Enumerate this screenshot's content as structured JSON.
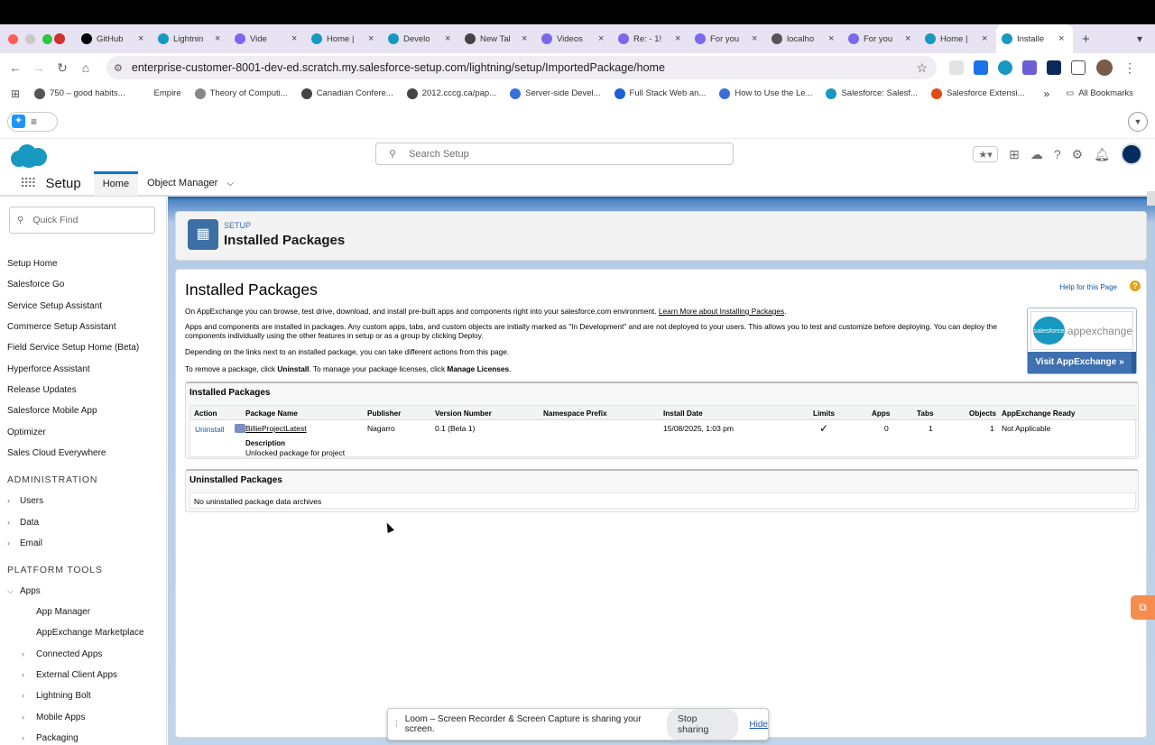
{
  "browser": {
    "tabs": [
      {
        "label": "GitHub",
        "icon": "github-icon",
        "color": "#000000"
      },
      {
        "label": "Lightnin",
        "icon": "salesforce-icon",
        "color": "#1798c1"
      },
      {
        "label": "Vide",
        "icon": "video-icon",
        "color": "#7b68ee"
      },
      {
        "label": "Home |",
        "icon": "salesforce-icon",
        "color": "#1798c1"
      },
      {
        "label": "Develo",
        "icon": "salesforce-icon",
        "color": "#1798c1"
      },
      {
        "label": "New Tal",
        "icon": "chrome-icon",
        "color": "#444444"
      },
      {
        "label": "Videos",
        "icon": "video-icon",
        "color": "#7b68ee"
      },
      {
        "label": "Re: - 1!",
        "icon": "video-icon",
        "color": "#7b68ee"
      },
      {
        "label": "For you",
        "icon": "video-icon",
        "color": "#7b68ee"
      },
      {
        "label": "localho",
        "icon": "globe-icon",
        "color": "#555555"
      },
      {
        "label": "For you",
        "icon": "video-icon",
        "color": "#7b68ee"
      },
      {
        "label": "Home |",
        "icon": "salesforce-icon",
        "color": "#1798c1"
      },
      {
        "label": "Installe",
        "icon": "salesforce-icon",
        "color": "#1798c1",
        "active": true
      }
    ],
    "url": "enterprise-customer-8001-dev-ed.scratch.my.salesforce-setup.com/lightning/setup/ImportedPackage/home",
    "bookmarks": [
      {
        "label": "750 – good habits...",
        "color": "#555555"
      },
      {
        "label": "Empire",
        "color": "#ffffff"
      },
      {
        "label": "Theory of Computi...",
        "color": "#888888"
      },
      {
        "label": "Canadian Confere...",
        "color": "#444444"
      },
      {
        "label": "2012.cccg.ca/pap...",
        "color": "#444444"
      },
      {
        "label": "Server-side Devel...",
        "color": "#3a6fd8"
      },
      {
        "label": "Full Stack Web an...",
        "color": "#1b5fd6"
      },
      {
        "label": "How to Use the Le...",
        "color": "#3a6fd8"
      },
      {
        "label": "Salesforce: Salesf...",
        "color": "#1798c1"
      },
      {
        "label": "Salesforce Extensi...",
        "color": "#e04b1a"
      }
    ],
    "bookmarks_more": "»",
    "all_bookmarks": "All Bookmarks"
  },
  "header": {
    "search_placeholder": "Search Setup",
    "app_name": "Setup",
    "nav_tabs": [
      {
        "label": "Home",
        "active": true
      },
      {
        "label": "Object Manager"
      }
    ]
  },
  "sidebar": {
    "quick_find_placeholder": "Quick Find",
    "items": [
      "Setup Home",
      "Salesforce Go",
      "Service Setup Assistant",
      "Commerce Setup Assistant",
      "Field Service Setup Home (Beta)",
      "Hyperforce Assistant",
      "Release Updates",
      "Salesforce Mobile App",
      "Optimizer",
      "Sales Cloud Everywhere"
    ],
    "admin_heading": "ADMINISTRATION",
    "admin_items": [
      "Users",
      "Data",
      "Email"
    ],
    "platform_heading": "PLATFORM TOOLS",
    "apps_label": "Apps",
    "apps_children": [
      {
        "label": "App Manager",
        "expandable": false
      },
      {
        "label": "AppExchange Marketplace",
        "expandable": false
      },
      {
        "label": "Connected Apps",
        "expandable": true
      },
      {
        "label": "External Client Apps",
        "expandable": true
      },
      {
        "label": "Lightning Bolt",
        "expandable": true
      },
      {
        "label": "Mobile Apps",
        "expandable": true
      },
      {
        "label": "Packaging",
        "expandable": true
      }
    ]
  },
  "page": {
    "eyebrow": "SETUP",
    "title": "Installed Packages",
    "heading": "Installed Packages",
    "help_link": "Help for this Page",
    "intro_1": "On AppExchange you can browse, test drive, download, and install pre-built apps and components right into your salesforce.com environment.",
    "intro_1_link": "Learn More about Installing Packages",
    "intro_2": "Apps and components are installed in packages. Any custom apps, tabs, and custom objects are initially marked as \"In Development\" and are not deployed to your users. This allows you to test and customize before deploying. You can deploy the components individually using the other features in setup or as a group by clicking Deploy.",
    "intro_3": "Depending on the links next to an installed package, you can take different actions from this page.",
    "intro_4_a": "To remove a package, click",
    "intro_4_uninstall": "Uninstall",
    "intro_4_b": ". To manage your package licenses, click",
    "intro_4_manage": "Manage Licenses",
    "intro_4_c": ".",
    "appexchange": {
      "badge": "salesforce",
      "word": "appexchange",
      "button": "Visit AppExchange »"
    }
  },
  "installed": {
    "heading": "Installed Packages",
    "columns": [
      "Action",
      "Package Name",
      "Publisher",
      "Version Number",
      "Namespace Prefix",
      "Install Date",
      "Limits",
      "Apps",
      "Tabs",
      "Objects",
      "AppExchange Ready"
    ],
    "rows": [
      {
        "action": "Uninstall",
        "name": "BillieProjectLatest",
        "publisher": "Nagarro",
        "version": "0.1 (Beta 1)",
        "namespace": "",
        "install_date": "15/08/2025, 1:03 pm",
        "limits": "✓",
        "apps": "0",
        "tabs": "1",
        "objects": "1",
        "appexchange_ready": "Not Applicable",
        "description_label": "Description",
        "description": "Unlocked package for project"
      }
    ]
  },
  "uninstalled": {
    "heading": "Uninstalled Packages",
    "empty": "No uninstalled package data archives"
  },
  "loom": {
    "message": "Loom – Screen Recorder & Screen Capture is sharing your screen.",
    "stop": "Stop sharing",
    "hide": "Hide"
  }
}
